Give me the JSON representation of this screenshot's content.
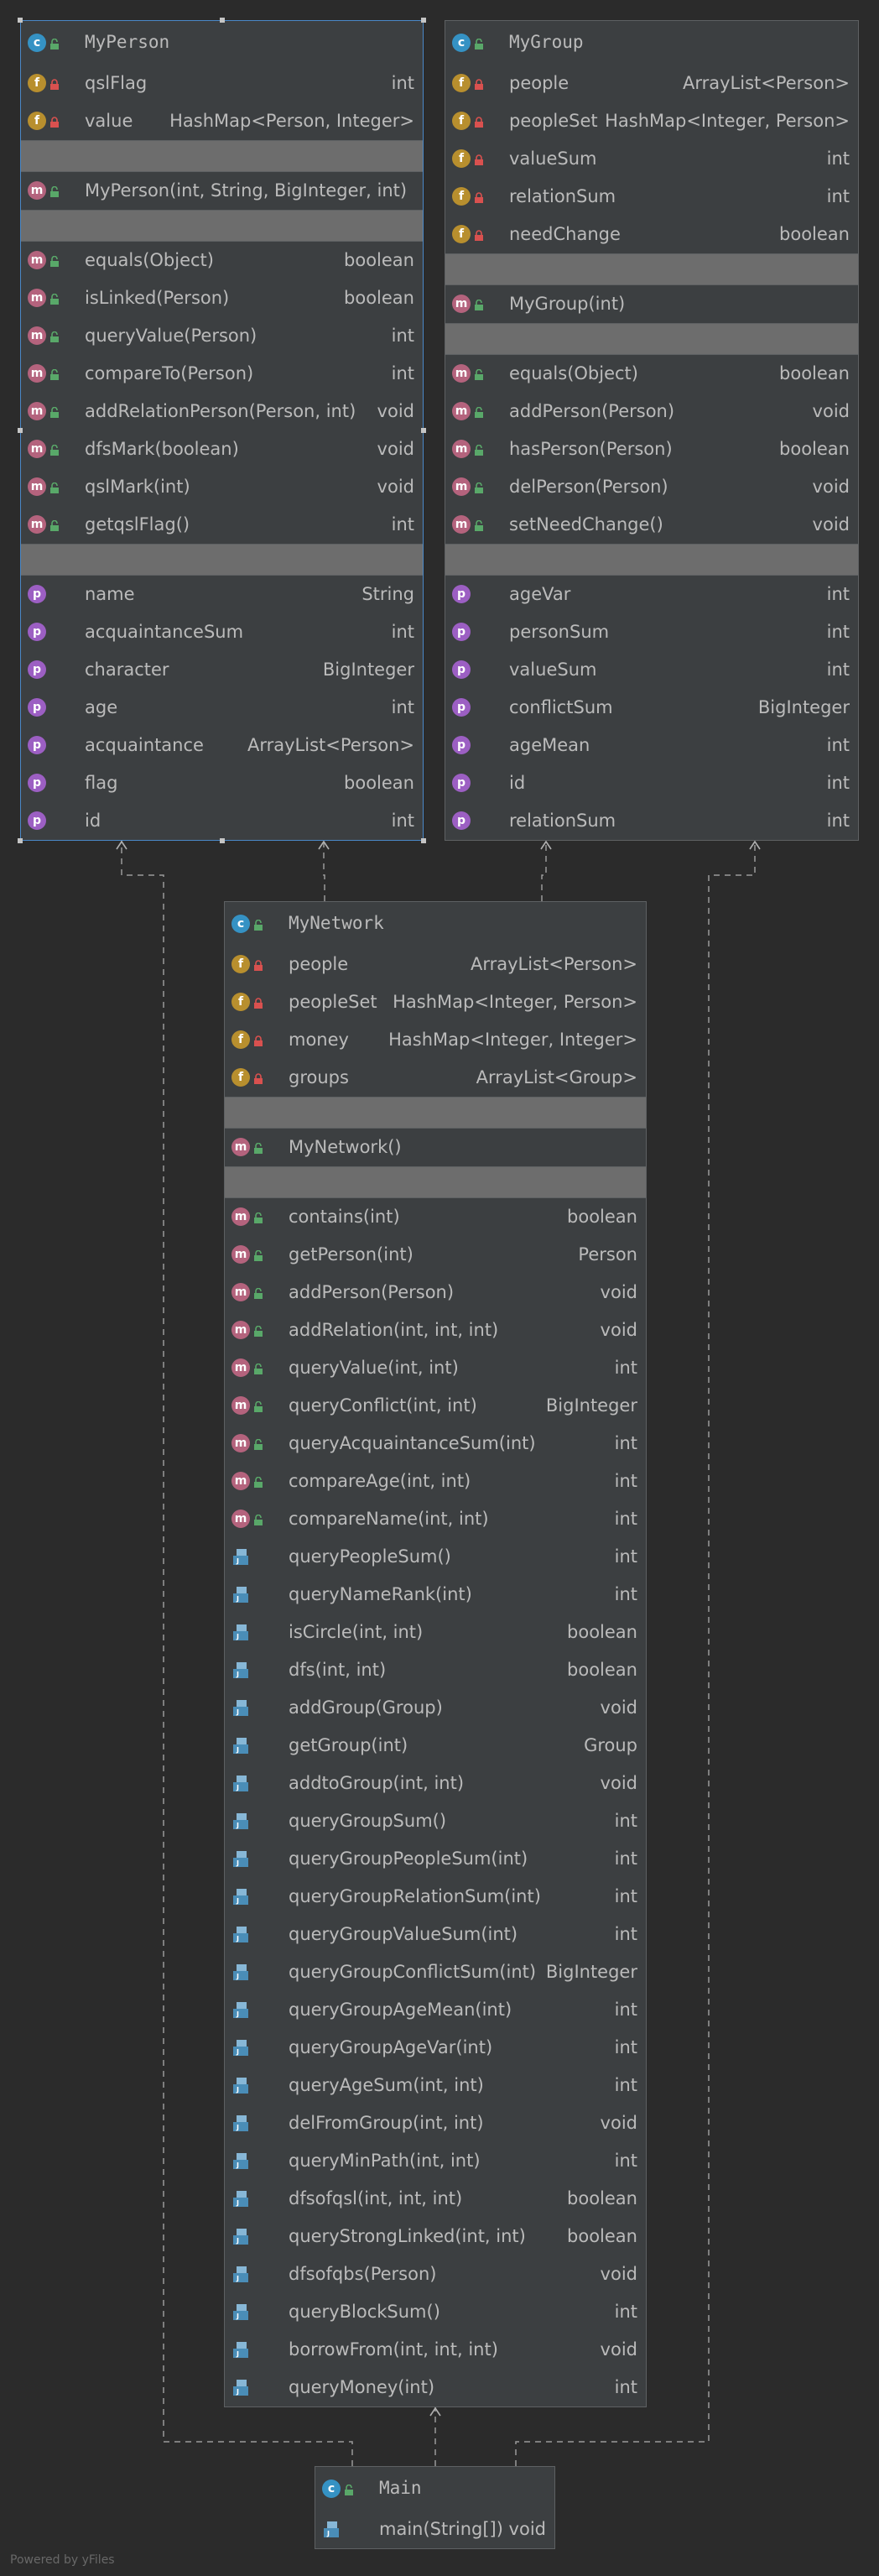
{
  "classes": {
    "myperson": {
      "name": "MyPerson",
      "fields": [
        {
          "name": "qslFlag",
          "type": "int"
        },
        {
          "name": "value",
          "type": "HashMap<Person, Integer>"
        }
      ],
      "constructors": [
        {
          "name": "MyPerson(int, String, BigInteger, int)",
          "type": ""
        }
      ],
      "methods": [
        {
          "name": "equals(Object)",
          "type": "boolean"
        },
        {
          "name": "isLinked(Person)",
          "type": "boolean"
        },
        {
          "name": "queryValue(Person)",
          "type": "int"
        },
        {
          "name": "compareTo(Person)",
          "type": "int"
        },
        {
          "name": "addRelationPerson(Person, int)",
          "type": "void"
        },
        {
          "name": "dfsMark(boolean)",
          "type": "void"
        },
        {
          "name": "qslMark(int)",
          "type": "void"
        },
        {
          "name": "getqslFlag()",
          "type": "int"
        }
      ],
      "properties": [
        {
          "name": "name",
          "type": "String"
        },
        {
          "name": "acquaintanceSum",
          "type": "int"
        },
        {
          "name": "character",
          "type": "BigInteger"
        },
        {
          "name": "age",
          "type": "int"
        },
        {
          "name": "acquaintance",
          "type": "ArrayList<Person>"
        },
        {
          "name": "flag",
          "type": "boolean"
        },
        {
          "name": "id",
          "type": "int"
        }
      ]
    },
    "mygroup": {
      "name": "MyGroup",
      "fields": [
        {
          "name": "people",
          "type": "ArrayList<Person>"
        },
        {
          "name": "peopleSet",
          "type": "HashMap<Integer, Person>"
        },
        {
          "name": "valueSum",
          "type": "int"
        },
        {
          "name": "relationSum",
          "type": "int"
        },
        {
          "name": "needChange",
          "type": "boolean"
        }
      ],
      "constructors": [
        {
          "name": "MyGroup(int)",
          "type": ""
        }
      ],
      "methods": [
        {
          "name": "equals(Object)",
          "type": "boolean"
        },
        {
          "name": "addPerson(Person)",
          "type": "void"
        },
        {
          "name": "hasPerson(Person)",
          "type": "boolean"
        },
        {
          "name": "delPerson(Person)",
          "type": "void"
        },
        {
          "name": "setNeedChange()",
          "type": "void"
        }
      ],
      "properties": [
        {
          "name": "ageVar",
          "type": "int"
        },
        {
          "name": "personSum",
          "type": "int"
        },
        {
          "name": "valueSum",
          "type": "int"
        },
        {
          "name": "conflictSum",
          "type": "BigInteger"
        },
        {
          "name": "ageMean",
          "type": "int"
        },
        {
          "name": "id",
          "type": "int"
        },
        {
          "name": "relationSum",
          "type": "int"
        }
      ]
    },
    "mynetwork": {
      "name": "MyNetwork",
      "fields": [
        {
          "name": "people",
          "type": "ArrayList<Person>"
        },
        {
          "name": "peopleSet",
          "type": "HashMap<Integer, Person>"
        },
        {
          "name": "money",
          "type": "HashMap<Integer, Integer>"
        },
        {
          "name": "groups",
          "type": "ArrayList<Group>"
        }
      ],
      "constructors": [
        {
          "name": "MyNetwork()",
          "type": ""
        }
      ],
      "methods": [
        {
          "name": "contains(int)",
          "type": "boolean",
          "kind": "m"
        },
        {
          "name": "getPerson(int)",
          "type": "Person",
          "kind": "m"
        },
        {
          "name": "addPerson(Person)",
          "type": "void",
          "kind": "m"
        },
        {
          "name": "addRelation(int, int, int)",
          "type": "void",
          "kind": "m"
        },
        {
          "name": "queryValue(int, int)",
          "type": "int",
          "kind": "m"
        },
        {
          "name": "queryConflict(int, int)",
          "type": "BigInteger",
          "kind": "m"
        },
        {
          "name": "queryAcquaintanceSum(int)",
          "type": "int",
          "kind": "m"
        },
        {
          "name": "compareAge(int, int)",
          "type": "int",
          "kind": "m"
        },
        {
          "name": "compareName(int, int)",
          "type": "int",
          "kind": "m"
        },
        {
          "name": "queryPeopleSum()",
          "type": "int",
          "kind": "i"
        },
        {
          "name": "queryNameRank(int)",
          "type": "int",
          "kind": "i"
        },
        {
          "name": "isCircle(int, int)",
          "type": "boolean",
          "kind": "i"
        },
        {
          "name": "dfs(int, int)",
          "type": "boolean",
          "kind": "i"
        },
        {
          "name": "addGroup(Group)",
          "type": "void",
          "kind": "i"
        },
        {
          "name": "getGroup(int)",
          "type": "Group",
          "kind": "i"
        },
        {
          "name": "addtoGroup(int, int)",
          "type": "void",
          "kind": "i"
        },
        {
          "name": "queryGroupSum()",
          "type": "int",
          "kind": "i"
        },
        {
          "name": "queryGroupPeopleSum(int)",
          "type": "int",
          "kind": "i"
        },
        {
          "name": "queryGroupRelationSum(int)",
          "type": "int",
          "kind": "i"
        },
        {
          "name": "queryGroupValueSum(int)",
          "type": "int",
          "kind": "i"
        },
        {
          "name": "queryGroupConflictSum(int)",
          "type": "BigInteger",
          "kind": "i"
        },
        {
          "name": "queryGroupAgeMean(int)",
          "type": "int",
          "kind": "i"
        },
        {
          "name": "queryGroupAgeVar(int)",
          "type": "int",
          "kind": "i"
        },
        {
          "name": "queryAgeSum(int, int)",
          "type": "int",
          "kind": "i"
        },
        {
          "name": "delFromGroup(int, int)",
          "type": "void",
          "kind": "i"
        },
        {
          "name": "queryMinPath(int, int)",
          "type": "int",
          "kind": "i"
        },
        {
          "name": "dfsofqsl(int, int, int)",
          "type": "boolean",
          "kind": "i"
        },
        {
          "name": "queryStrongLinked(int, int)",
          "type": "boolean",
          "kind": "i"
        },
        {
          "name": "dfsofqbs(Person)",
          "type": "void",
          "kind": "i"
        },
        {
          "name": "queryBlockSum()",
          "type": "int",
          "kind": "i"
        },
        {
          "name": "borrowFrom(int, int, int)",
          "type": "void",
          "kind": "i"
        },
        {
          "name": "queryMoney(int)",
          "type": "int",
          "kind": "i"
        }
      ]
    },
    "main": {
      "name": "Main",
      "methods": [
        {
          "name": "main(String[])",
          "type": "void",
          "kind": "i"
        }
      ]
    }
  },
  "footer": "Powered by yFiles",
  "colors": {
    "background": "#2b2b2b",
    "node": "#3c3f41",
    "separator": "#6d6d6d",
    "class_icon": "#3592c4",
    "field_icon": "#b88f2e",
    "method_icon": "#b4637d",
    "property_icon": "#9c5fc3"
  }
}
